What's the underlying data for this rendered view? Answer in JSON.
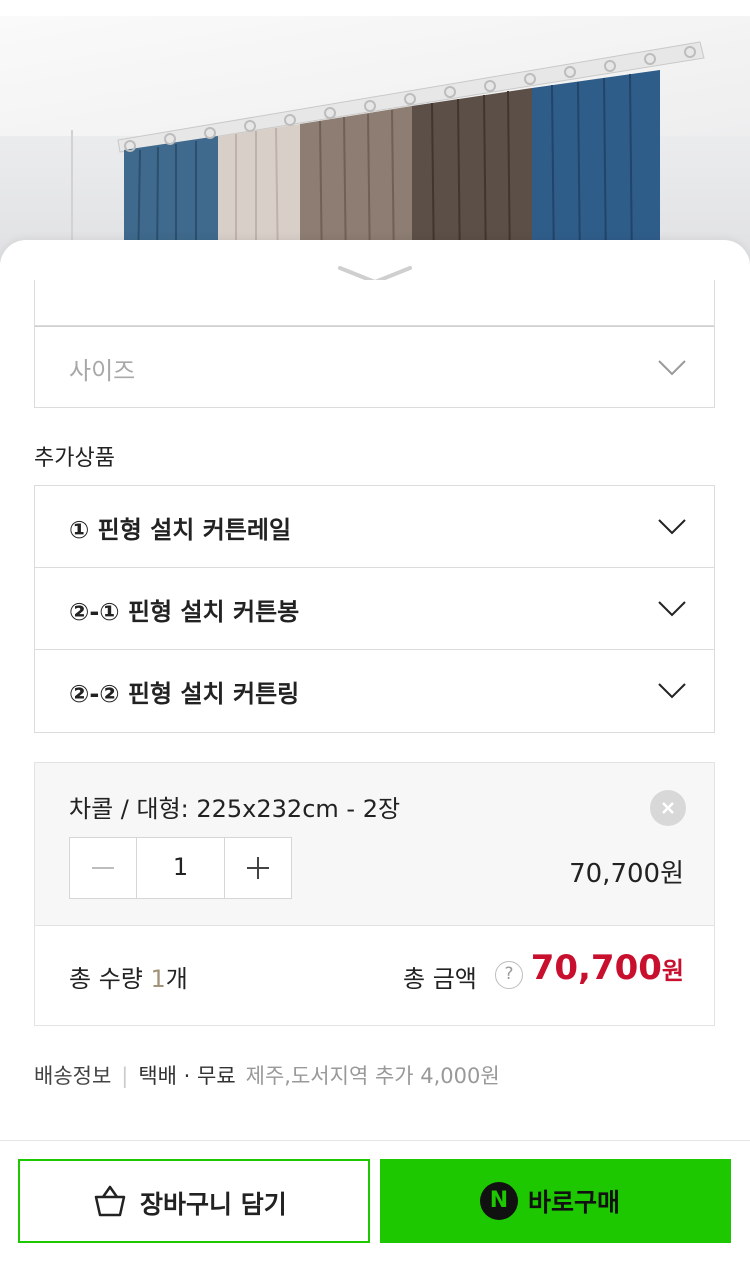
{
  "sheet": {
    "size_select": {
      "placeholder": "사이즈"
    },
    "addons_title": "추가상품",
    "addons": [
      {
        "label": "① 핀형 설치 커튼레일"
      },
      {
        "label": "②-① 핀형 설치 커튼봉"
      },
      {
        "label": "②-② 핀형 설치 커튼링"
      }
    ]
  },
  "selected_option": {
    "name": "차콜 / 대형: 225x232cm - 2장",
    "quantity": "1",
    "price": "70,700원"
  },
  "total": {
    "quantity_label": "총 수량",
    "quantity_value": "1",
    "quantity_unit": "개",
    "amount_label": "총 금액",
    "help_icon": "?",
    "amount_value": "70,700",
    "amount_unit": "원"
  },
  "shipping": {
    "label": "배송정보",
    "method": "택배 · 무료",
    "extra": "제주,도서지역 추가 4,000원"
  },
  "actions": {
    "cart_label": "장바구니 담기",
    "buy_logo": "N",
    "buy_label": "바로구매"
  },
  "colors": {
    "accent_green": "#1ec800",
    "price_red": "#c8102e",
    "curtain_blue": "#2f5d8a",
    "curtain_steel": "#3f6a8d",
    "curtain_beige": "#d9cfc9",
    "curtain_taupe": "#8d7d72",
    "curtain_brown": "#5c4f47"
  }
}
